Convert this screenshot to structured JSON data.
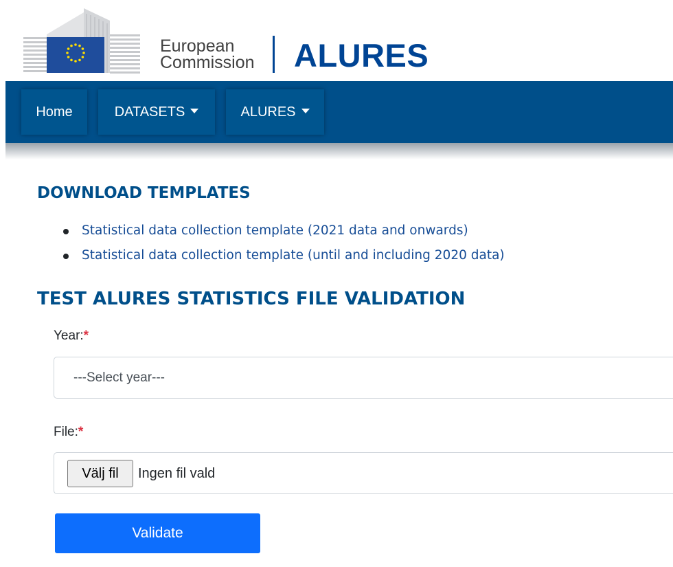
{
  "header": {
    "logo_line1": "European",
    "logo_line2": "Commission",
    "site_title": "ALURES"
  },
  "navbar": {
    "items": [
      {
        "label": "Home",
        "dropdown": false
      },
      {
        "label": "DATASETS",
        "dropdown": true
      },
      {
        "label": "ALURES",
        "dropdown": true
      }
    ]
  },
  "download_section": {
    "title": "DOWNLOAD TEMPLATES",
    "links": [
      "Statistical data collection template (2021 data and onwards)",
      "Statistical data collection template (until and including 2020 data)"
    ]
  },
  "validation_section": {
    "title": "TEST ALURES STATISTICS FILE VALIDATION",
    "year_label": "Year:",
    "year_placeholder": "---Select year---",
    "file_label": "File:",
    "required_marker": "*",
    "file_button_label": "Välj fil",
    "file_status": "Ingen fil vald",
    "validate_label": "Validate"
  },
  "colors": {
    "brand_blue": "#004494",
    "navbar_blue": "#004f8a",
    "link_blue": "#174d96",
    "primary_button": "#0d6efd",
    "required_red": "#dc3545",
    "eu_flag_blue": "#1f4d9c",
    "eu_star_yellow": "#ffde00"
  }
}
